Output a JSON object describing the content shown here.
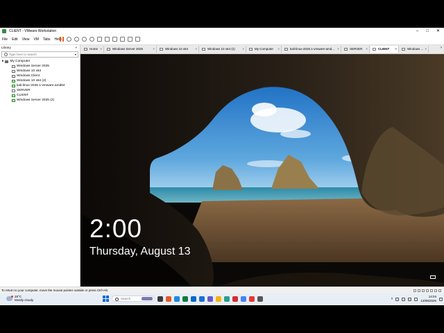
{
  "window": {
    "title": "CLIENT - VMware Workstation",
    "controls": [
      "–",
      "□",
      "✕"
    ]
  },
  "menu": [
    "File",
    "Edit",
    "View",
    "VM",
    "Tabs",
    "Help"
  ],
  "library": {
    "title": "Library",
    "search_placeholder": "Type here to search",
    "root": "My Computer",
    "items": [
      {
        "label": "Windows Server 2025",
        "running": false
      },
      {
        "label": "Windows 10 x64",
        "running": false
      },
      {
        "label": "Windows Client",
        "running": false
      },
      {
        "label": "Windows 10 x64 (2)",
        "running": true
      },
      {
        "label": "kali-linux-2026.1-vmware-amd64",
        "running": true
      },
      {
        "label": "SERVER",
        "running": false
      },
      {
        "label": "CLIENT",
        "running": true
      },
      {
        "label": "Windows Server 2025 (2)",
        "running": true
      }
    ]
  },
  "tabs": [
    {
      "label": "Home",
      "active": false
    },
    {
      "label": "Windows Server 2025",
      "active": false
    },
    {
      "label": "Windows 10 x64",
      "active": false
    },
    {
      "label": "Windows 10 x64 (2)",
      "active": false
    },
    {
      "label": "My Computer",
      "active": false
    },
    {
      "label": "kali-linux-2026.1-vmware-amd...",
      "active": false
    },
    {
      "label": "SERVER",
      "active": false
    },
    {
      "label": "CLIENT",
      "active": true
    },
    {
      "label": "Windows ...",
      "active": false
    }
  ],
  "lockscreen": {
    "time": "2:00",
    "date": "Thursday, August 13"
  },
  "status_bar": {
    "text": "To return to your computer, move the mouse pointer outside or press Ctrl+Alt."
  },
  "taskbar": {
    "weather_temp": "28°C",
    "weather_desc": "Mostly cloudy",
    "search_placeholder": "Search",
    "time": "14:04",
    "date": "13/08/2026",
    "apps": [
      "#3a3a3a",
      "#e35b2a",
      "#1e88e5",
      "#107c41",
      "#0a66d0",
      "#1f6fd1",
      "#6a5acd",
      "#f4b400",
      "#2a9d8f",
      "#d32f2f",
      "#4285f4",
      "#e53935",
      "#555555"
    ]
  },
  "colors": {
    "accent": "#0a66d0",
    "running_vm": "#2a8a2a",
    "pause": "#e55b1f"
  }
}
